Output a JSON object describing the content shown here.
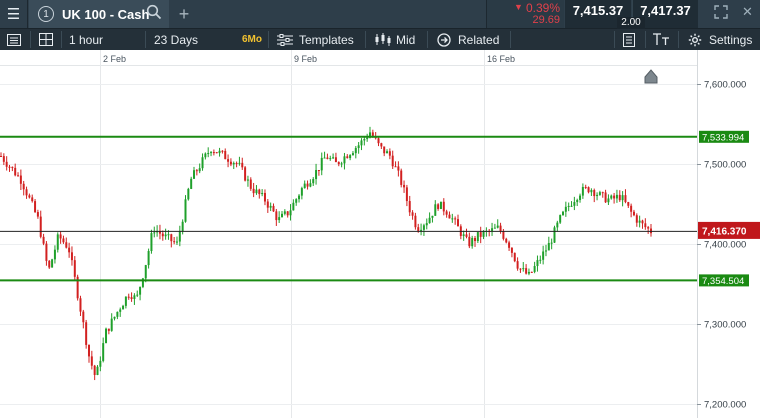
{
  "topbar": {
    "menu_icon": "hamburger-icon",
    "tab_number": "1",
    "instrument": "UK 100 - Cash",
    "search_icon": "search-icon",
    "add_icon": "plus-icon",
    "change_arrow": "▼",
    "change_pct": "0.39%",
    "change_points": "29.69",
    "sell_price": "7,415.37",
    "spread": "2.00",
    "buy_price": "7,417.37",
    "expand_icon": "expand-icon",
    "close_icon": "close-icon"
  },
  "toolbar": {
    "panel_icon": "panel-layout-icon",
    "grid_icon": "grid-layout-icon",
    "interval": "1 hour",
    "period": "23 Days",
    "period_badge": "6Mo",
    "templates_label": "Templates",
    "indicator_label": "Mid",
    "related_label": "Related",
    "notes_icon": "notes-icon",
    "text_icon": "text-size-icon",
    "settings_label": "Settings"
  },
  "colors": {
    "up": "#1fa02b",
    "down": "#d22020",
    "support_line": "#1a8a12",
    "price_label": "#c0171b"
  },
  "chart_data": {
    "type": "candlestick",
    "x_tick_labels": [
      "2 Feb",
      "9 Feb",
      "16 Feb"
    ],
    "y_tick_labels": [
      "7,600.000",
      "7,500.000",
      "7,400.000",
      "7,300.000",
      "7,200.000"
    ],
    "ylim": [
      7180,
      7620
    ],
    "grid": true,
    "horizontal_lines": [
      {
        "value": 7533.994,
        "label": "7,533.994"
      },
      {
        "value": 7354.504,
        "label": "7,354.504"
      }
    ],
    "current_price": {
      "value": 7416.37,
      "label": "7,416.370"
    },
    "price_path": [
      [
        0,
        7510
      ],
      [
        0.03,
        7480
      ],
      [
        0.055,
        7430
      ],
      [
        0.07,
        7365
      ],
      [
        0.085,
        7410
      ],
      [
        0.1,
        7395
      ],
      [
        0.115,
        7330
      ],
      [
        0.13,
        7260
      ],
      [
        0.14,
        7232
      ],
      [
        0.155,
        7290
      ],
      [
        0.175,
        7320
      ],
      [
        0.19,
        7340
      ],
      [
        0.2,
        7330
      ],
      [
        0.215,
        7380
      ],
      [
        0.225,
        7420
      ],
      [
        0.24,
        7410
      ],
      [
        0.26,
        7400
      ],
      [
        0.28,
        7480
      ],
      [
        0.295,
        7500
      ],
      [
        0.31,
        7520
      ],
      [
        0.33,
        7510
      ],
      [
        0.35,
        7500
      ],
      [
        0.37,
        7470
      ],
      [
        0.39,
        7455
      ],
      [
        0.41,
        7430
      ],
      [
        0.425,
        7440
      ],
      [
        0.445,
        7470
      ],
      [
        0.465,
        7490
      ],
      [
        0.48,
        7510
      ],
      [
        0.495,
        7500
      ],
      [
        0.515,
        7515
      ],
      [
        0.53,
        7525
      ],
      [
        0.545,
        7540
      ],
      [
        0.56,
        7520
      ],
      [
        0.575,
        7510
      ],
      [
        0.59,
        7480
      ],
      [
        0.605,
        7440
      ],
      [
        0.615,
        7420
      ],
      [
        0.63,
        7430
      ],
      [
        0.645,
        7450
      ],
      [
        0.66,
        7440
      ],
      [
        0.675,
        7420
      ],
      [
        0.69,
        7400
      ],
      [
        0.705,
        7410
      ],
      [
        0.72,
        7415
      ],
      [
        0.735,
        7420
      ],
      [
        0.75,
        7400
      ],
      [
        0.765,
        7370
      ],
      [
        0.78,
        7360
      ],
      [
        0.795,
        7380
      ],
      [
        0.81,
        7400
      ],
      [
        0.825,
        7430
      ],
      [
        0.84,
        7450
      ],
      [
        0.855,
        7465
      ],
      [
        0.87,
        7470
      ],
      [
        0.885,
        7460
      ],
      [
        0.9,
        7455
      ],
      [
        0.915,
        7460
      ],
      [
        0.93,
        7440
      ],
      [
        0.945,
        7425
      ],
      [
        0.96,
        7416
      ]
    ]
  }
}
